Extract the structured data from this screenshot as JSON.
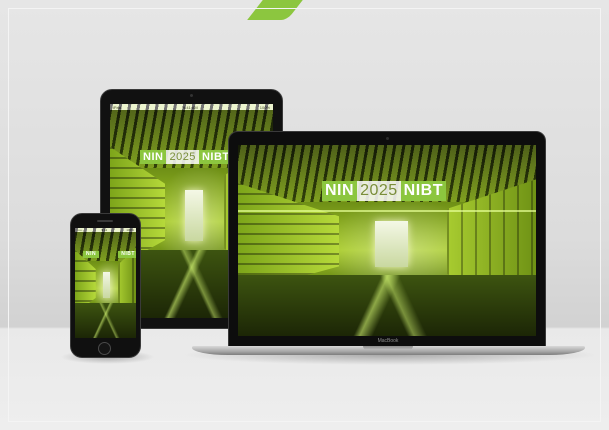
{
  "scene": {
    "description_colors": {
      "accent_green": "#8cc63f",
      "wall": "#dcdcdc",
      "device_black": "#111111"
    }
  },
  "logo": {
    "part1": "NIN",
    "part2": "2025",
    "part3": "NIBT"
  },
  "laptop": {
    "brand_label": "MacBook"
  },
  "tablet": {
    "status_left": "iPad",
    "status_center": "9:41 AM",
    "status_right": "100%"
  },
  "phone": {
    "status_left": "•••••",
    "status_center": "9:41",
    "status_right": "100%"
  }
}
